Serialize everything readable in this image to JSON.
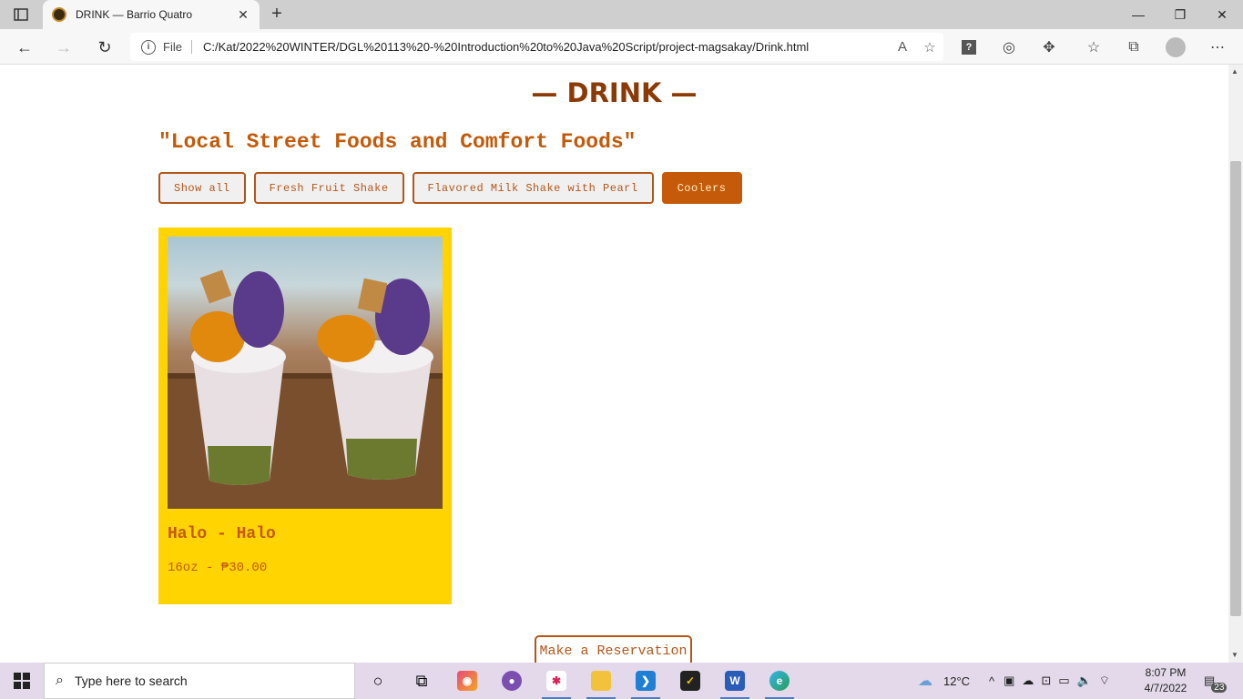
{
  "browser": {
    "tab_title": "DRINK — Barrio Quatro",
    "url_scheme": "File",
    "url": "C:/Kat/2022%20WINTER/DGL%20113%20-%20Introduction%20to%20Java%20Script/project-magsakay/Drink.html"
  },
  "page": {
    "heading": "— DRINK —",
    "tagline": "\"Local Street Foods and Comfort Foods\"",
    "filters": [
      {
        "label": "Show all",
        "active": false
      },
      {
        "label": "Fresh Fruit Shake",
        "active": false
      },
      {
        "label": "Flavored Milk Shake with Pearl",
        "active": false
      },
      {
        "label": "Coolers",
        "active": true
      }
    ],
    "items": [
      {
        "name": "Halo - Halo",
        "price": "16oz - ₱30.00"
      }
    ],
    "reserve_label": "Make a Reservation"
  },
  "taskbar": {
    "search_placeholder": "Type here to search",
    "weather": "12°C",
    "time": "8:07 PM",
    "date": "4/7/2022",
    "notification_count": "23"
  },
  "colors": {
    "heading": "#8b3a06",
    "accent": "#c25a0a",
    "card": "#ffd400",
    "active_filter": "#c55a0a"
  }
}
